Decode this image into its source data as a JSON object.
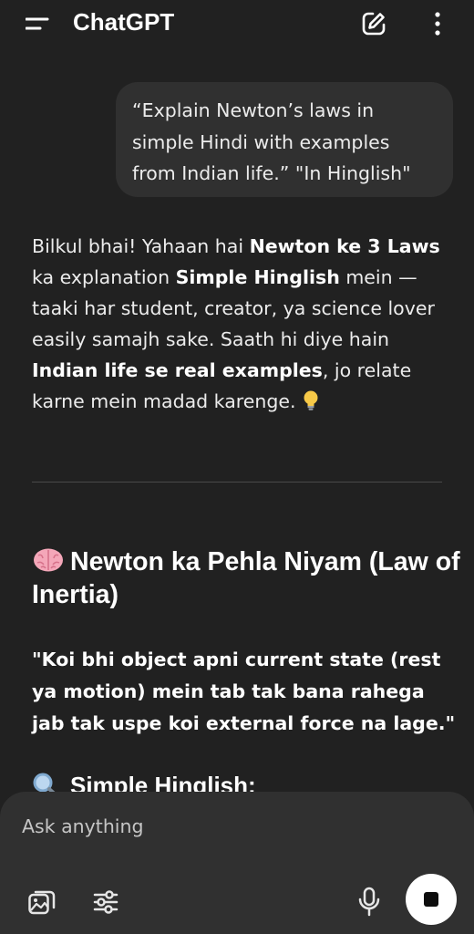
{
  "header": {
    "title": "ChatGPT",
    "menu_icon": "menu-icon",
    "new_chat_icon": "edit-icon",
    "more_icon": "more-vertical-icon"
  },
  "user_message": {
    "text": "“Explain Newton’s laws in simple Hindi with examples from Indian life.” \"In Hinglish\""
  },
  "assistant_message": {
    "intro": {
      "t1": "Bilkul bhai! Yahaan hai ",
      "b1": "Newton ke 3 Laws",
      "t2": " ka explanation ",
      "b2": "Simple Hinglish",
      "t3": " mein — taaki har student, creator, ya science lover easily samajh sake. Saath hi diye hain ",
      "b3": "Indian life se real examples",
      "t4": ", jo relate karne mein madad karenge.",
      "emoji": "lightbulb-icon"
    },
    "section_heading": "Newton ka Pehla Niyam (Law of Inertia)",
    "section_emoji": "brain-icon",
    "quote": "\"Koi bhi object apni current state (rest ya motion) mein tab tak bana rahega jab tak uspe koi external force na lage.\"",
    "sub_heading": "Simple Hinglish:",
    "sub_emoji": "magnifier-icon"
  },
  "composer": {
    "placeholder": "Ask anything",
    "attach_icon": "image-attach-icon",
    "tools_icon": "sliders-icon",
    "mic_icon": "microphone-icon",
    "stop_icon": "stop-icon"
  },
  "colors": {
    "background": "#212121",
    "bubble": "#303030",
    "text": "#ececec",
    "stop_button": "#ffffff"
  }
}
